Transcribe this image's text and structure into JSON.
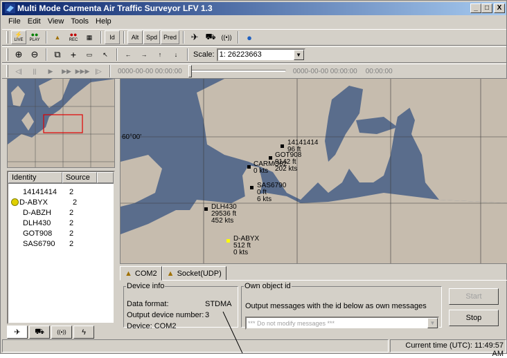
{
  "window": {
    "title": "Multi Mode Carmenta Air Traffic Surveyor LFV 1.3",
    "min": "_",
    "max": "□",
    "close": "X"
  },
  "menu": [
    "File",
    "Edit",
    "View",
    "Tools",
    "Help"
  ],
  "toolbar1": {
    "live": "LIVE",
    "play": "PLAY",
    "rec": "REC",
    "id": "Id",
    "alt": "Alt",
    "spd": "Spd",
    "pred": "Pred"
  },
  "toolbar2": {
    "scale_label": "Scale:",
    "scale_value": "1: 26223663"
  },
  "playback": {
    "start_time": "0000-00-00 00:00:00",
    "end_time": "0000-00-00 00:00:00",
    "elapsed": "00:00:00",
    "position": 0
  },
  "map": {
    "lat_label": "60°00'",
    "tracks": [
      {
        "lines": [
          "14141414",
          "96 ft"
        ]
      },
      {
        "lines": [
          "GOT908",
          "9142 ft",
          "202 kts"
        ]
      },
      {
        "lines": [
          "CARMO02",
          "0 kts"
        ]
      },
      {
        "lines": [
          "SAS6790",
          "0 ft",
          "6 kts"
        ]
      },
      {
        "lines": [
          "DLH430",
          "29536 ft",
          "452 kts"
        ]
      },
      {
        "lines": [
          "D-ABYX",
          "512 ft",
          "0 kts"
        ]
      }
    ]
  },
  "list": {
    "headers": [
      "Identity",
      "Source"
    ],
    "rows": [
      {
        "identity": "14141414",
        "source": "2"
      },
      {
        "identity": "D-ABYX",
        "source": "2"
      },
      {
        "identity": "D-ABZH",
        "source": "2"
      },
      {
        "identity": "DLH430",
        "source": "2"
      },
      {
        "identity": "GOT908",
        "source": "2"
      },
      {
        "identity": "SAS6790",
        "source": "2"
      }
    ]
  },
  "tabs": [
    "COM2",
    "Socket(UDP)"
  ],
  "device_info": {
    "legend": "Device info",
    "data_format_label": "Data format:",
    "data_format": "STDMA",
    "output_label": "Output device number:",
    "output_value": "3",
    "device": "Device: COM2"
  },
  "own_object": {
    "legend": "Own object id",
    "description": "Output messages with the id below as own messages",
    "select_value": "*** Do not modify messages ***"
  },
  "buttons": {
    "start": "Start",
    "stop": "Stop"
  },
  "status": {
    "right": "Current time (UTC): 11:49:57 AM"
  },
  "colors": {
    "water": "#5a6d8c",
    "land": "#c6bcae",
    "titlebar": "#0a246a"
  }
}
